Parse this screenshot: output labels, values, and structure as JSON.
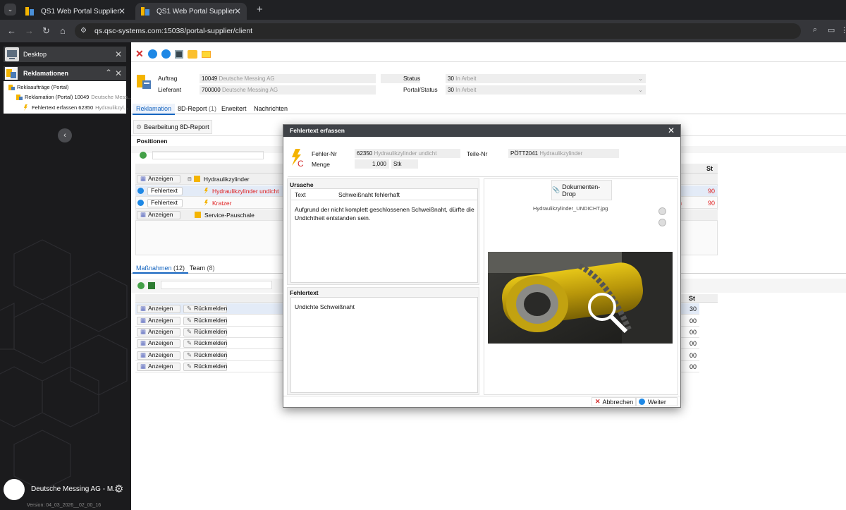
{
  "browser": {
    "tabs": [
      {
        "title": "QS1 Web Portal Supplier",
        "active": false
      },
      {
        "title": "QS1 Web Portal Supplier",
        "active": true
      }
    ],
    "url": "qs.qsc-systems.com:15038/portal-supplier/client"
  },
  "sidebar": {
    "desktop_label": "Desktop",
    "module_label": "Reklamationen",
    "tree": [
      "Reklaaufträge (Portal)",
      "Reklamation (Portal) 10049",
      "Fehlertext erfassen 62350"
    ],
    "tree_dim": [
      "",
      "Deutsche Mess...",
      "Hydraulikzyl..."
    ],
    "user_label": "Deutsche Messing AG - M...",
    "version": "Version: 04_03_2026__02_00_16"
  },
  "header": {
    "auftrag_label": "Auftrag",
    "auftrag_value": "10049",
    "auftrag_dim": "Deutsche Messing AG",
    "lieferant_label": "Lieferant",
    "lieferant_value": "700000",
    "lieferant_dim": "Deutsche Messing AG",
    "status_label": "Status",
    "status_value": "30",
    "status_dim": "In Arbeit",
    "portal_status_label": "Portal/Status",
    "portal_status_value": "30",
    "portal_status_dim": "In Arbeit"
  },
  "tabs_main": [
    "Reklamation",
    "8D-Report",
    "Erweitert",
    "Nachrichten"
  ],
  "tab_8d_count": "(1)",
  "bearbeitung_button": "Bearbeitung 8D-Report",
  "positionen": {
    "title": "Positionen",
    "col_st": "St",
    "rows": [
      {
        "btn": "Anzeigen",
        "text": "Hydraulikzylinder",
        "st": "",
        "red": false
      },
      {
        "btn": "Fehlertext",
        "text": "Hydraulikzylinder undicht",
        "st": "90",
        "red": true
      },
      {
        "btn": "Fehlertext",
        "text": "Kratzer",
        "st": "90",
        "red": true
      },
      {
        "btn": "Anzeigen",
        "text": "Service-Pauschale",
        "st": "",
        "red": false
      }
    ],
    "partial_cell": "n"
  },
  "lower_tabs": {
    "massnahmen": "Maßnahmen",
    "massnahmen_count": "(12)",
    "team": "Team",
    "team_count": "(8)"
  },
  "massnahmen": {
    "col_st": "St",
    "rows": [
      {
        "a": "Anzeigen",
        "b": "Rückmelden",
        "st": "30"
      },
      {
        "a": "Anzeigen",
        "b": "Rückmelden",
        "st": "00"
      },
      {
        "a": "Anzeigen",
        "b": "Rückmelden",
        "st": "00"
      },
      {
        "a": "Anzeigen",
        "b": "Rückmelden",
        "st": "00"
      },
      {
        "a": "Anzeigen",
        "b": "Rückmelden",
        "st": "00"
      },
      {
        "a": "Anzeigen",
        "b": "Rückmelden",
        "st": "00"
      }
    ]
  },
  "modal": {
    "title": "Fehlertext erfassen",
    "fehler_nr_label": "Fehler-Nr",
    "fehler_nr_value": "62350",
    "fehler_nr_dim": "Hydraulikzylinder undicht",
    "teile_nr_label": "Teile-Nr",
    "teile_nr_value": "PÖTT2041",
    "teile_nr_dim": "Hydraulikzylinder",
    "menge_label": "Menge",
    "menge_value": "1,000",
    "menge_unit": "Stk",
    "ursache_title": "Ursache",
    "text_label": "Text",
    "text_value": "Schweißnaht fehlerhaft",
    "ursache_body": "Aufgrund der nicht komplett geschlossenen Schweißnaht, dürfte die Undichtheit entstanden sein.",
    "fehlertext_title": "Fehlertext",
    "fehlertext_body": "Undichte Schweißnaht",
    "dokumente_button": "Dokumenten-Drop",
    "filename": "Hydraulikzylinder_UNDICHT.jpg",
    "abbrechen": "Abbrechen",
    "weiter": "Weiter"
  },
  "colors": {
    "accent": "#1565c0",
    "danger": "#e02020",
    "modal_header": "#3f4247"
  }
}
